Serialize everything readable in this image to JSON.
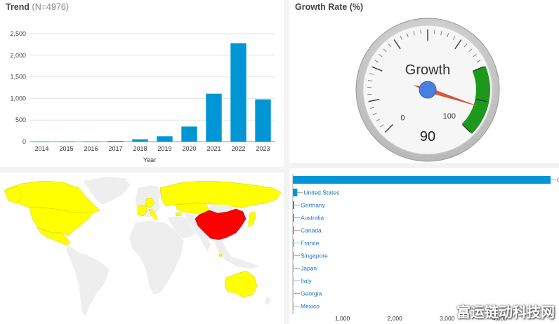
{
  "trend": {
    "title": "Trend",
    "subtitle": "(N=4976)"
  },
  "gauge": {
    "title": "Growth Rate (%)",
    "label": "Growth",
    "value": 90,
    "value_text": "90",
    "min": 0,
    "max": 100,
    "min_text": "0",
    "max_text": "100",
    "green_from": 75,
    "green_to": 100,
    "colors": {
      "green": "#1a9a1a",
      "needle": "#d9573b",
      "hub": "#4a7fe0",
      "bezel": "#d8d8d8"
    }
  },
  "map": {
    "colors": {
      "highlight": "#ff0000",
      "present": "#ffff00",
      "none": "#eeeeee"
    },
    "highlight": [
      "China"
    ],
    "present": [
      "Canada",
      "United States",
      "Mexico",
      "Russia",
      "Kazakhstan",
      "Germany",
      "France",
      "Italy",
      "Georgia",
      "Japan",
      "Singapore",
      "Australia"
    ]
  },
  "chart_data": [
    {
      "type": "bar",
      "categories": [
        "2014",
        "2015",
        "2016",
        "2017",
        "2018",
        "2019",
        "2020",
        "2021",
        "2022",
        "2023"
      ],
      "values": [
        2,
        3,
        5,
        15,
        55,
        125,
        350,
        1110,
        2280,
        980
      ],
      "xlabel": "Year",
      "ylabel": "",
      "ylim": [
        0,
        2500
      ],
      "yticks": [
        "0",
        "500",
        "1,000",
        "1,500",
        "2,000",
        "2,500"
      ],
      "grid": true,
      "color": "#0096d6"
    },
    {
      "type": "bar",
      "orientation": "horizontal",
      "categories": [
        "China",
        "United States",
        "Germany",
        "Australia",
        "Canada",
        "France",
        "Singapore",
        "Japan",
        "Italy",
        "Georgia",
        "Mexico"
      ],
      "values": [
        4920,
        85,
        25,
        20,
        18,
        15,
        12,
        10,
        8,
        6,
        5
      ],
      "xlim": [
        0,
        5000
      ],
      "xticks": [
        "1,000",
        "2,000",
        "3,000",
        "4,000"
      ],
      "color": "#0096d6"
    }
  ]
}
